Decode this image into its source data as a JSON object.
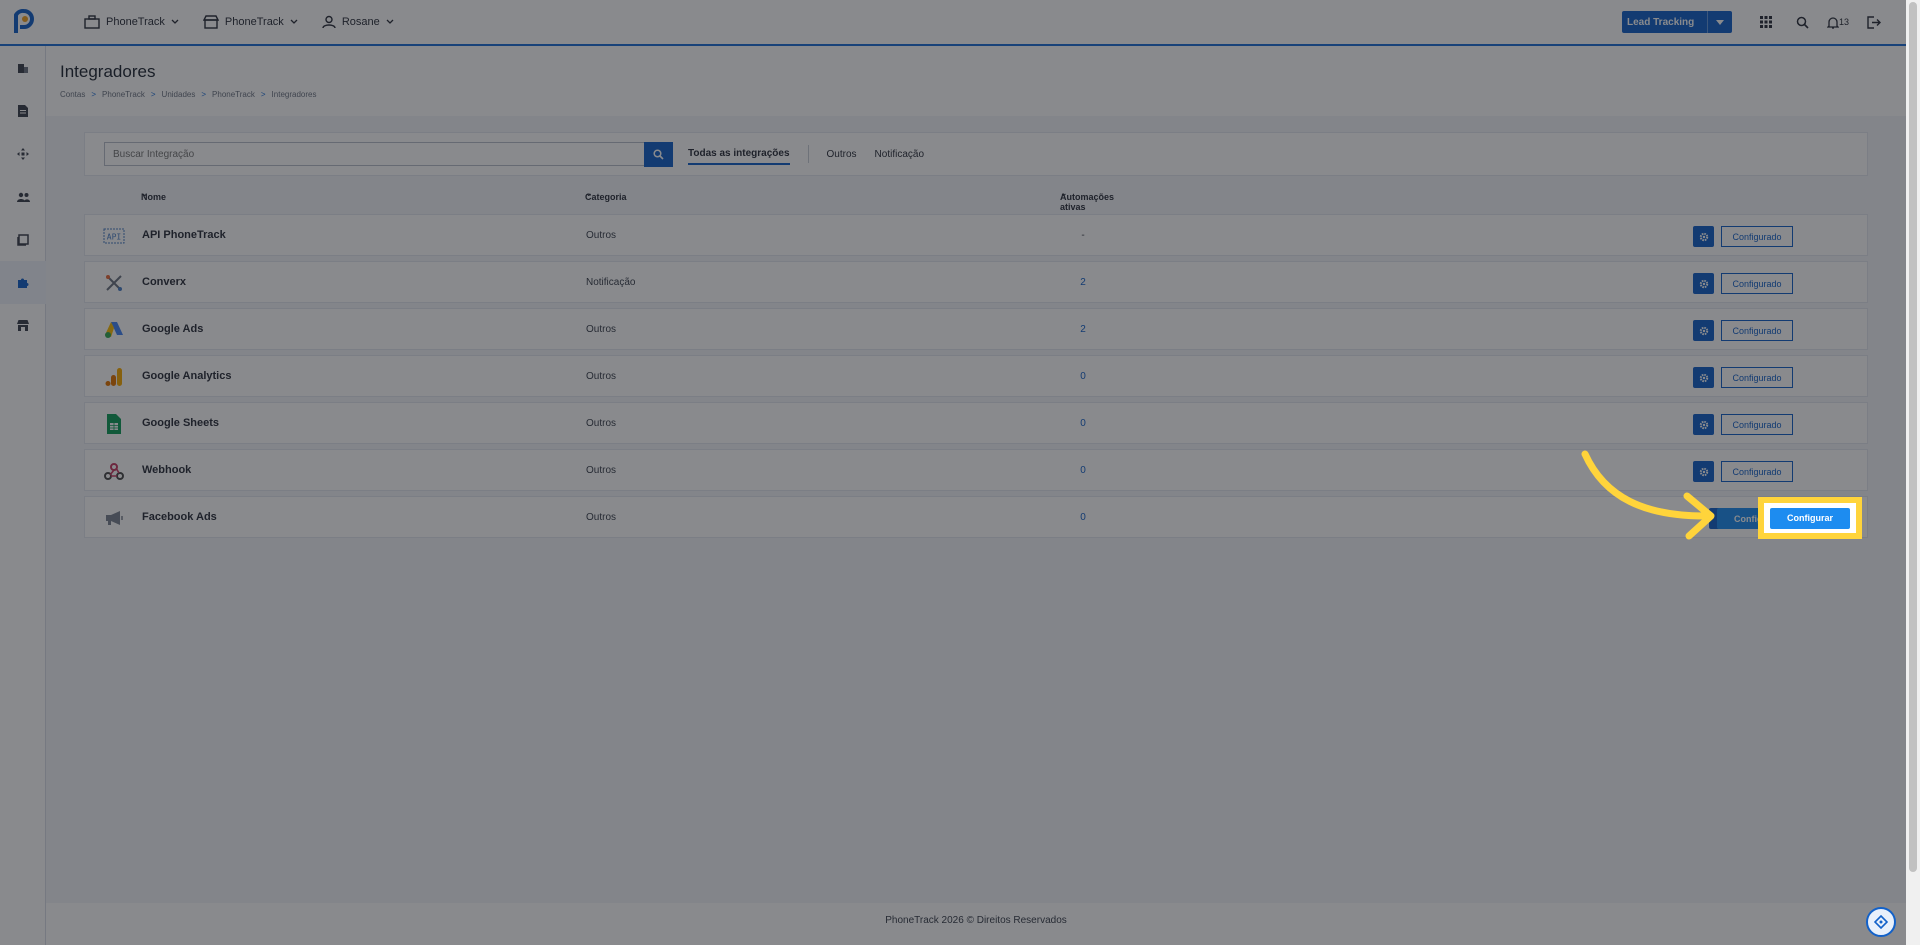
{
  "topbar": {
    "menus": [
      {
        "label": "PhoneTrack",
        "icon": "briefcase-icon"
      },
      {
        "label": "PhoneTrack",
        "icon": "store-icon"
      },
      {
        "label": "Rosane",
        "icon": "user-icon"
      }
    ],
    "lead_button": "Lead Tracking",
    "notification_count": "13"
  },
  "page": {
    "title": "Integradores",
    "breadcrumb": [
      "Contas",
      "PhoneTrack",
      "Unidades",
      "PhoneTrack",
      "Integradores"
    ],
    "breadcrumb_separator": ">"
  },
  "search": {
    "placeholder": "Buscar Integração"
  },
  "tabs": [
    "Todas as integrações",
    "Outros",
    "Notificação"
  ],
  "table": {
    "headers": [
      "Nome",
      "Categoria",
      "Automações ativas"
    ],
    "rows": [
      {
        "name": "API PhoneTrack",
        "category": "Outros",
        "automations": "-",
        "action": "Configurado",
        "icon": "api-icon"
      },
      {
        "name": "Converx",
        "category": "Notificação",
        "automations": "2",
        "action": "Configurado",
        "icon": "converx-icon"
      },
      {
        "name": "Google Ads",
        "category": "Outros",
        "automations": "2",
        "action": "Configurado",
        "icon": "google-ads-icon"
      },
      {
        "name": "Google Analytics",
        "category": "Outros",
        "automations": "0",
        "action": "Configurado",
        "icon": "google-analytics-icon"
      },
      {
        "name": "Google Sheets",
        "category": "Outros",
        "automations": "0",
        "action": "Configurado",
        "icon": "google-sheets-icon"
      },
      {
        "name": "Webhook",
        "category": "Outros",
        "automations": "0",
        "action": "Configurado",
        "icon": "webhook-icon"
      },
      {
        "name": "Facebook Ads",
        "category": "Outros",
        "automations": "0",
        "action": "Configurar",
        "icon": "megaphone-icon"
      }
    ]
  },
  "footer": "PhoneTrack 2026 © Direitos Reservados",
  "highlight_button": "Configurar",
  "colors": {
    "primary": "#1261c9",
    "accent": "#1d8cf0",
    "highlight": "#ffd43b"
  }
}
